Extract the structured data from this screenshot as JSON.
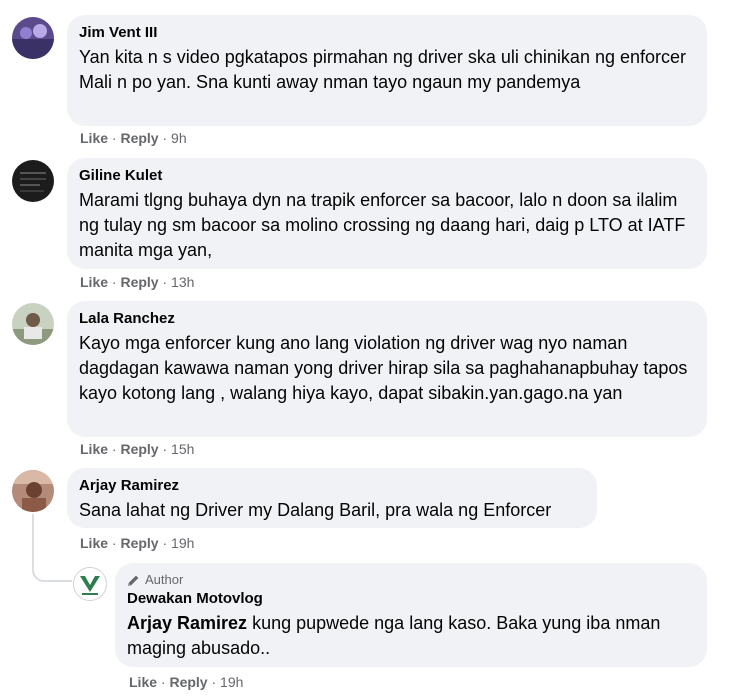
{
  "comments": [
    {
      "name": "Jim Vent III",
      "text": "Yan kita n s video pgkatapos pirmahan ng driver ska uli chinikan ng enforcer Mali n po yan. Sna kunti away nman tayo ngaun my pandemya",
      "like": "Like",
      "reply": "Reply",
      "time": "9h"
    },
    {
      "name": "Giline Kulet",
      "text": "Marami tlgng buhaya dyn na trapik enforcer sa bacoor, lalo n doon sa ilalim ng tulay ng sm bacoor sa molino crossing ng daang hari, daig p LTO at IATF manita mga yan,",
      "like": "Like",
      "reply": "Reply",
      "time": "13h"
    },
    {
      "name": "Lala Ranchez",
      "text": "Kayo mga enforcer kung ano lang violation ng driver wag nyo naman dagdagan kawawa naman yong driver hirap sila sa paghahanapbuhay tapos kayo kotong lang , walang hiya kayo, dapat sibakin.yan.gago.na yan",
      "like": "Like",
      "reply": "Reply",
      "time": "15h"
    },
    {
      "name": "Arjay Ramirez",
      "text": "Sana lahat ng Driver my Dalang Baril, pra wala ng Enforcer",
      "like": "Like",
      "reply": "Reply",
      "time": "19h"
    }
  ],
  "reply": {
    "author_badge": "Author",
    "name": "Dewakan Motovlog",
    "mention": "Arjay Ramirez",
    "text": " kung pupwede nga lang kaso. Baka yung iba nman maging abusado..",
    "like": "Like",
    "reply": "Reply",
    "time": "19h"
  },
  "separator": "·",
  "colors": {
    "bubble_bg": "#f0f2f5",
    "action_text": "#65676b",
    "text": "#050505"
  }
}
